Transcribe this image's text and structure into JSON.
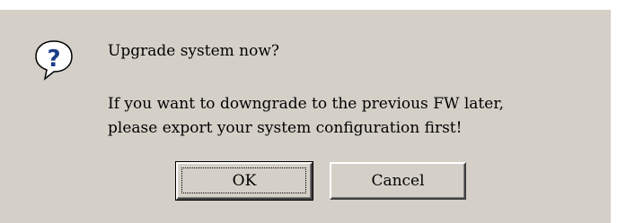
{
  "dialog": {
    "icon": "question-icon",
    "question": "Upgrade system now?",
    "message_line1": "If you want to downgrade to the previous FW later,",
    "message_line2": "please export your system configuration first!",
    "buttons": {
      "ok_label": "OK",
      "cancel_label": "Cancel"
    },
    "colors": {
      "background": "#d4d0c8",
      "icon_fill": "#ffffff",
      "icon_glyph": "#1a3c8a"
    }
  }
}
